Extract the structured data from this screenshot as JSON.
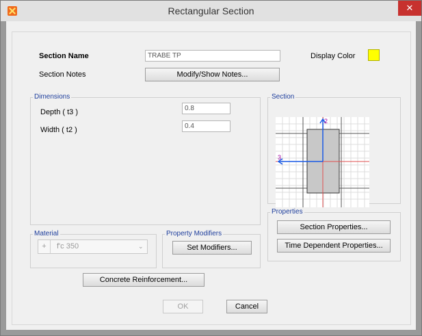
{
  "window": {
    "title": "Rectangular Section",
    "close_symbol": "✕"
  },
  "section_name": {
    "label": "Section Name",
    "value": "TRABE TP"
  },
  "display_color": {
    "label": "Display Color",
    "color": "#ffff00"
  },
  "section_notes": {
    "label": "Section Notes",
    "button": "Modify/Show Notes..."
  },
  "dimensions": {
    "title": "Dimensions",
    "depth": {
      "label": "Depth  ( t3 )",
      "value": "0.8"
    },
    "width": {
      "label": "Width  ( t2 )",
      "value": "0.4"
    }
  },
  "section_preview": {
    "title": "Section",
    "axis_2": "2",
    "axis_3": "3"
  },
  "material": {
    "title": "Material",
    "plus": "+",
    "value": "f'c 350",
    "arrow": "⌄"
  },
  "property_modifiers": {
    "title": "Property Modifiers",
    "button": "Set Modifiers..."
  },
  "properties": {
    "title": "Properties",
    "section_button": "Section Properties...",
    "time_button": "Time Dependent Properties..."
  },
  "reinforcement": {
    "button": "Concrete Reinforcement..."
  },
  "footer": {
    "ok": "OK",
    "cancel": "Cancel"
  }
}
